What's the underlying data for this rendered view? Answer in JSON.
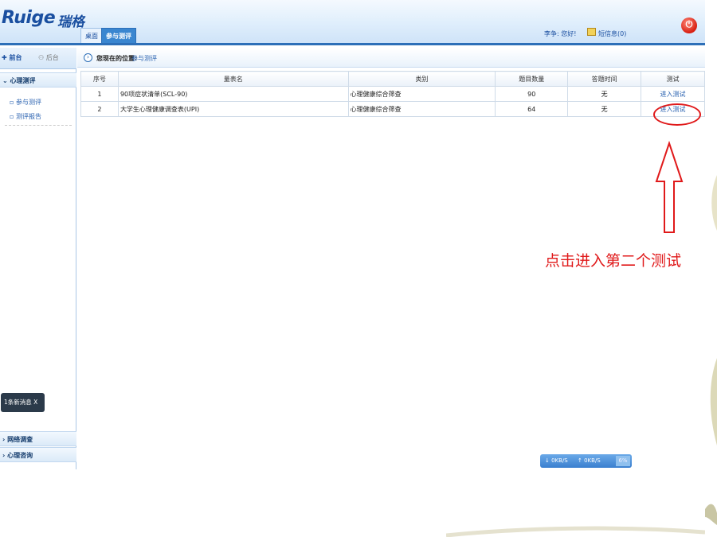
{
  "header": {
    "logo_text": "Ruige",
    "logo_cn": "瑞格",
    "tabs": [
      {
        "label": "桌面"
      },
      {
        "label": "参与测评"
      }
    ],
    "greeting": "李争: 您好!",
    "messages": "短信息(0)",
    "power_icon": "power-icon"
  },
  "sidebar": {
    "front_label": "前台",
    "back_label": "后台",
    "section_psych": "心理测评",
    "items": [
      {
        "label": "参与测评"
      },
      {
        "label": "测评报告"
      }
    ],
    "notice": "1条新消息  X",
    "section_net": "网络调查",
    "section_consult": "心理咨询"
  },
  "breadcrumb": {
    "label": "您现在的位置:",
    "value": "参与测评"
  },
  "table": {
    "headers": [
      "序号",
      "量表名",
      "类别",
      "题目数量",
      "答题时间",
      "测试"
    ],
    "rows": [
      {
        "no": "1",
        "name": "90项症状清单(SCL-90)",
        "category": "心理健康综合筛查",
        "count": "90",
        "time": "无",
        "action": "进入测试"
      },
      {
        "no": "2",
        "name": "大学生心理健康调查表(UPI)",
        "category": "心理健康综合筛查",
        "count": "64",
        "time": "无",
        "action": "进入测试"
      }
    ]
  },
  "speed_widget": {
    "down": "0KB/S",
    "up": "0KB/S",
    "percent": "6%"
  },
  "annotation": {
    "text": "点击进入第二个测试",
    "color": "#e0191a"
  },
  "colors": {
    "brand_blue": "#1a4fa0",
    "accent_blue": "#2d6fb8"
  }
}
